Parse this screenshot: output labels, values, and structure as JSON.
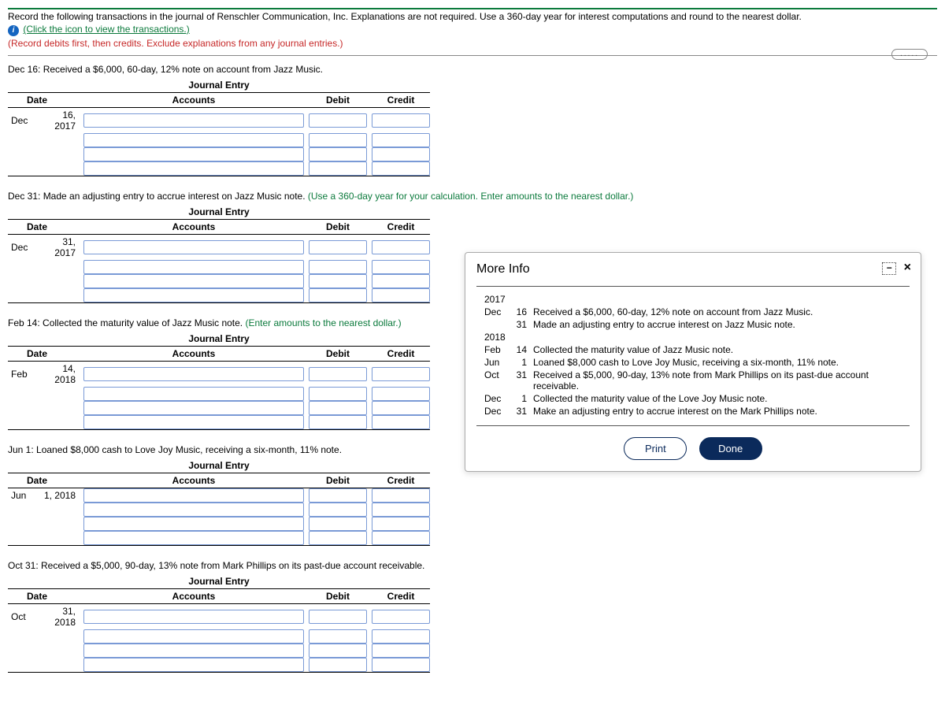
{
  "header": {
    "main_instruction": "Record the following transactions in the journal of Renschler Communication, Inc. Explanations are not required. Use a 360-day year for interest computations and round to the nearest dollar.",
    "icon_link_text": "(Click the icon to view the transactions.)",
    "sub_instruction_red": "(Record debits first, then credits. Exclude explanations from any journal entries.)",
    "dotted_button": "....."
  },
  "entries": [
    {
      "prompt": "Dec 16: Received a $6,000, 60-day, 12% note on account from Jazz Music.",
      "hint": "",
      "month": "Dec",
      "day": "16, 2017"
    },
    {
      "prompt": "Dec 31: Made an adjusting entry to accrue interest on Jazz Music note. ",
      "hint": "(Use a 360-day year for your calculation. Enter amounts to the nearest dollar.)",
      "month": "Dec",
      "day": "31, 2017"
    },
    {
      "prompt": "Feb 14: Collected the maturity value of Jazz Music note. ",
      "hint": "(Enter amounts to the nearest dollar.)",
      "month": "Feb",
      "day": "14, 2018"
    },
    {
      "prompt": "Jun 1: Loaned $8,000 cash to Love Joy Music, receiving a six-month, 11% note.",
      "hint": "",
      "month": "Jun",
      "day": "1, 2018"
    },
    {
      "prompt": "Oct 31: Received a $5,000, 90-day, 13% note from Mark Phillips on its past-due account receivable.",
      "hint": "",
      "month": "Oct",
      "day": "31, 2018"
    }
  ],
  "je_labels": {
    "title": "Journal Entry",
    "date": "Date",
    "accounts": "Accounts",
    "debit": "Debit",
    "credit": "Credit"
  },
  "modal": {
    "title": "More Info",
    "year1": "2017",
    "year2": "2018",
    "rows": [
      {
        "month": "Dec",
        "day": "16",
        "text": "Received a $6,000, 60-day, 12% note on account from Jazz Music."
      },
      {
        "month": "",
        "day": "31",
        "text": "Made an adjusting entry to accrue interest on Jazz Music note."
      },
      {
        "month": "Feb",
        "day": "14",
        "text": "Collected the maturity value of Jazz Music note."
      },
      {
        "month": "Jun",
        "day": "1",
        "text": "Loaned $8,000 cash to Love Joy Music, receiving a six-month, 11% note."
      },
      {
        "month": "Oct",
        "day": "31",
        "text": "Received a $5,000, 90-day, 13% note from Mark Phillips on its past-due account receivable."
      },
      {
        "month": "Dec",
        "day": "1",
        "text": "Collected the maturity value of the Love Joy Music note."
      },
      {
        "month": "Dec",
        "day": "31",
        "text": "Make an adjusting entry to accrue interest on the Mark Phillips note."
      }
    ],
    "print": "Print",
    "done": "Done"
  }
}
